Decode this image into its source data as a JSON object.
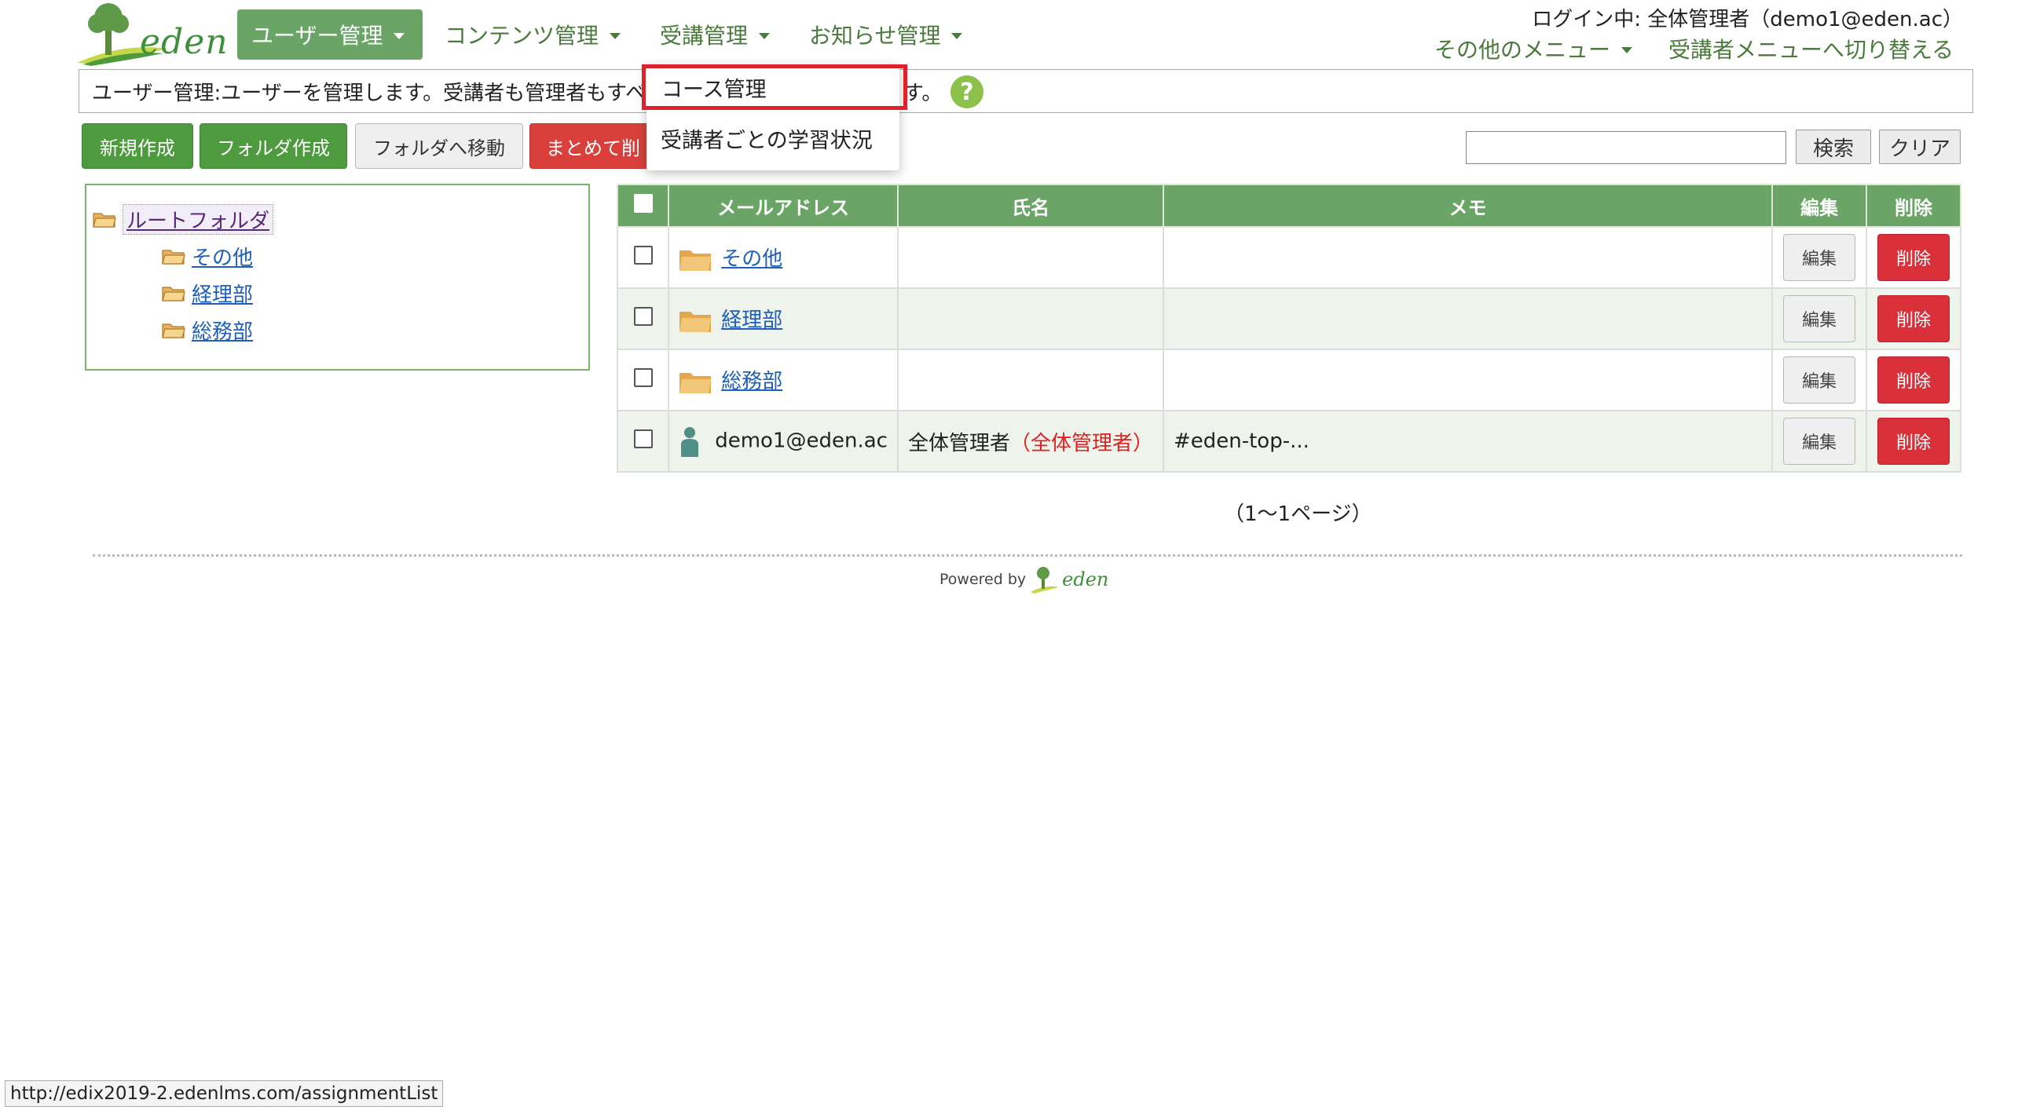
{
  "brand": {
    "logo_text": "eden",
    "powered_by": "Powered by"
  },
  "nav": {
    "items": [
      {
        "label": "ユーザー管理"
      },
      {
        "label": "コンテンツ管理"
      },
      {
        "label": "受講管理"
      },
      {
        "label": "お知らせ管理"
      }
    ],
    "active_index": 0
  },
  "header": {
    "login_label": "ログイン中:",
    "login_user": "全体管理者（demo1@eden.ac）",
    "other_menu": "その他のメニュー",
    "switch_menu": "受講者メニューへ切り替える"
  },
  "description": {
    "text": "ユーザー管理:ユーザーを管理します。受講者も管理者もすべ",
    "tail": "す。",
    "help": "?"
  },
  "dropdown": {
    "items": [
      {
        "label": "コース管理",
        "highlighted": true
      },
      {
        "label": "受講者ごとの学習状況",
        "highlighted": false
      }
    ]
  },
  "toolbar": {
    "new_label": "新規作成",
    "new_folder_label": "フォルダ作成",
    "move_label": "フォルダへ移動",
    "bulk_delete_label": "まとめて削",
    "search_value": "",
    "search_label": "検索",
    "clear_label": "クリア"
  },
  "tree": {
    "root": "ルートフォルダ",
    "children": [
      "その他",
      "経理部",
      "総務部"
    ]
  },
  "table": {
    "headers": {
      "email": "メールアドレス",
      "name": "氏名",
      "memo": "メモ",
      "edit": "編集",
      "delete": "削除"
    },
    "rows": [
      {
        "type": "folder",
        "email": "その他",
        "name": "",
        "role": "",
        "memo": ""
      },
      {
        "type": "folder",
        "email": "経理部",
        "name": "",
        "role": "",
        "memo": ""
      },
      {
        "type": "folder",
        "email": "総務部",
        "name": "",
        "role": "",
        "memo": ""
      },
      {
        "type": "user",
        "email": "demo1@eden.ac",
        "name": "全体管理者",
        "role": "（全体管理者）",
        "memo": "#eden-top-..."
      }
    ],
    "edit_label": "編集",
    "delete_label": "削除"
  },
  "pager": {
    "text": "（1〜1ページ）"
  },
  "statusbar": {
    "url": "http://edix2019-2.edenlms.com/assignmentList"
  },
  "colors": {
    "accent_green": "#6aa567",
    "link_blue": "#1f5fb8",
    "delete_red": "#d9303a",
    "highlight_red": "#e0202a"
  },
  "icons": {
    "folder": "folder-icon",
    "user": "person-icon",
    "help": "help-icon",
    "logo": "tree-logo-icon"
  }
}
